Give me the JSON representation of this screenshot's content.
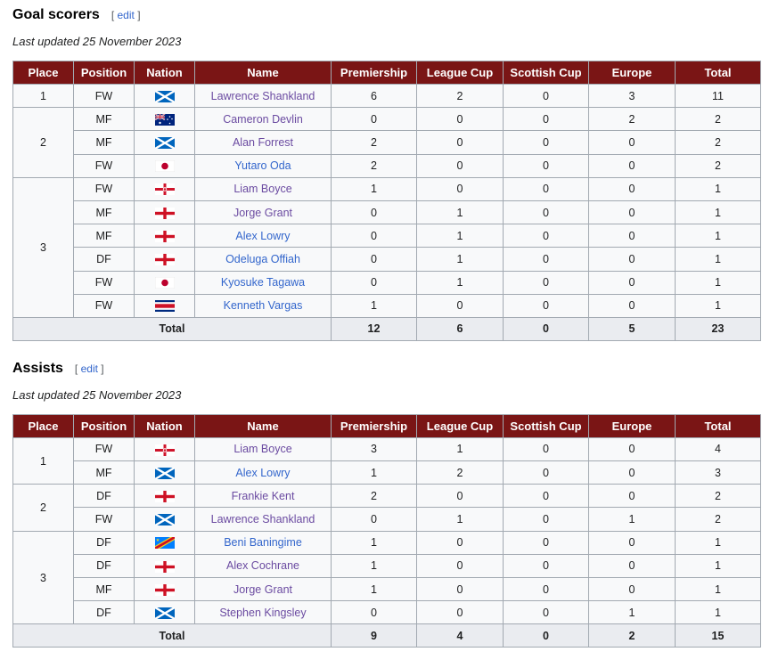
{
  "columns": [
    "Place",
    "Position",
    "Nation",
    "Name",
    "Premiership",
    "League Cup",
    "Scottish Cup",
    "Europe",
    "Total"
  ],
  "goals": {
    "title": "Goal scorers",
    "edit": "edit",
    "updated": "Last updated 25 November 2023",
    "places": [
      {
        "place": "1",
        "rows": [
          {
            "pos": "FW",
            "flag": "scotland-flag-icon",
            "name": "Lawrence Shankland",
            "visited": true,
            "prem": "6",
            "lc": "2",
            "sc": "0",
            "eu": "3",
            "total": "11"
          }
        ]
      },
      {
        "place": "2",
        "rows": [
          {
            "pos": "MF",
            "flag": "australia-flag-icon",
            "name": "Cameron Devlin",
            "visited": true,
            "prem": "0",
            "lc": "0",
            "sc": "0",
            "eu": "2",
            "total": "2"
          },
          {
            "pos": "MF",
            "flag": "scotland-flag-icon",
            "name": "Alan Forrest",
            "visited": true,
            "prem": "2",
            "lc": "0",
            "sc": "0",
            "eu": "0",
            "total": "2"
          },
          {
            "pos": "FW",
            "flag": "japan-flag-icon",
            "name": "Yutaro Oda",
            "visited": false,
            "prem": "2",
            "lc": "0",
            "sc": "0",
            "eu": "0",
            "total": "2"
          }
        ]
      },
      {
        "place": "3",
        "rows": [
          {
            "pos": "FW",
            "flag": "northern-ireland-flag-icon",
            "name": "Liam Boyce",
            "visited": true,
            "prem": "1",
            "lc": "0",
            "sc": "0",
            "eu": "0",
            "total": "1"
          },
          {
            "pos": "MF",
            "flag": "england-flag-icon",
            "name": "Jorge Grant",
            "visited": true,
            "prem": "0",
            "lc": "1",
            "sc": "0",
            "eu": "0",
            "total": "1"
          },
          {
            "pos": "MF",
            "flag": "england-flag-icon",
            "name": "Alex Lowry",
            "visited": false,
            "prem": "0",
            "lc": "1",
            "sc": "0",
            "eu": "0",
            "total": "1"
          },
          {
            "pos": "DF",
            "flag": "england-flag-icon",
            "name": "Odeluga Offiah",
            "visited": false,
            "prem": "0",
            "lc": "1",
            "sc": "0",
            "eu": "0",
            "total": "1"
          },
          {
            "pos": "FW",
            "flag": "japan-flag-icon",
            "name": "Kyosuke Tagawa",
            "visited": false,
            "prem": "0",
            "lc": "1",
            "sc": "0",
            "eu": "0",
            "total": "1"
          },
          {
            "pos": "FW",
            "flag": "costa-rica-flag-icon",
            "name": "Kenneth Vargas",
            "visited": false,
            "prem": "1",
            "lc": "0",
            "sc": "0",
            "eu": "0",
            "total": "1"
          }
        ]
      }
    ],
    "totals": {
      "label": "Total",
      "prem": "12",
      "lc": "6",
      "sc": "0",
      "eu": "5",
      "total": "23"
    }
  },
  "assists": {
    "title": "Assists",
    "edit": "edit",
    "updated": "Last updated 25 November 2023",
    "places": [
      {
        "place": "1",
        "rows": [
          {
            "pos": "FW",
            "flag": "northern-ireland-flag-icon",
            "name": "Liam Boyce",
            "visited": true,
            "prem": "3",
            "lc": "1",
            "sc": "0",
            "eu": "0",
            "total": "4"
          },
          {
            "pos": "MF",
            "flag": "scotland-flag-icon",
            "name": "Alex Lowry",
            "visited": false,
            "prem": "1",
            "lc": "2",
            "sc": "0",
            "eu": "0",
            "total": "3"
          }
        ]
      },
      {
        "place": "2",
        "rows": [
          {
            "pos": "DF",
            "flag": "england-flag-icon",
            "name": "Frankie Kent",
            "visited": true,
            "prem": "2",
            "lc": "0",
            "sc": "0",
            "eu": "0",
            "total": "2"
          },
          {
            "pos": "FW",
            "flag": "scotland-flag-icon",
            "name": "Lawrence Shankland",
            "visited": true,
            "prem": "0",
            "lc": "1",
            "sc": "0",
            "eu": "1",
            "total": "2"
          }
        ]
      },
      {
        "place": "3",
        "rows": [
          {
            "pos": "DF",
            "flag": "dr-congo-flag-icon",
            "name": "Beni Baningime",
            "visited": false,
            "prem": "1",
            "lc": "0",
            "sc": "0",
            "eu": "0",
            "total": "1"
          },
          {
            "pos": "DF",
            "flag": "england-flag-icon",
            "name": "Alex Cochrane",
            "visited": true,
            "prem": "1",
            "lc": "0",
            "sc": "0",
            "eu": "0",
            "total": "1"
          },
          {
            "pos": "MF",
            "flag": "england-flag-icon",
            "name": "Jorge Grant",
            "visited": true,
            "prem": "1",
            "lc": "0",
            "sc": "0",
            "eu": "0",
            "total": "1"
          },
          {
            "pos": "DF",
            "flag": "scotland-flag-icon",
            "name": "Stephen Kingsley",
            "visited": true,
            "prem": "0",
            "lc": "0",
            "sc": "0",
            "eu": "1",
            "total": "1"
          }
        ]
      }
    ],
    "totals": {
      "label": "Total",
      "prem": "9",
      "lc": "4",
      "sc": "0",
      "eu": "2",
      "total": "15"
    }
  },
  "colors": {
    "header_bg": "#7a1515",
    "link": "#3366cc",
    "visited_link": "#6b4ba1",
    "total_row_bg": "#eaecf0"
  }
}
